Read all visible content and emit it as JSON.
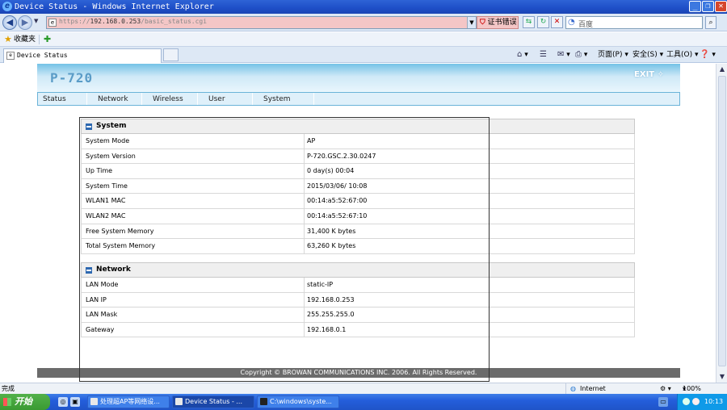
{
  "window": {
    "title": "Device Status - Windows Internet Explorer",
    "icon": "e"
  },
  "toolbar": {
    "url_prefix": "https://",
    "url_host": "192.168.0.253",
    "url_path": "/basic_status.cgi",
    "cert_error": "证书错误",
    "search_placeholder": "百度"
  },
  "favorites": {
    "label": "收藏夹"
  },
  "tab": {
    "title": "Device Status"
  },
  "commands": {
    "page": "页面(P)",
    "safety": "安全(S)",
    "tools": "工具(O)"
  },
  "device": {
    "logo": "P-720",
    "exit": "EXIT",
    "menu": [
      "Status",
      "Network",
      "Wireless",
      "User",
      "System"
    ],
    "system_section": {
      "title": "System",
      "rows": [
        {
          "key": "System Mode",
          "value": "AP"
        },
        {
          "key": "System Version",
          "value": "P-720.GSC.2.30.0247"
        },
        {
          "key": "Up Time",
          "value": "0 day(s) 00:04"
        },
        {
          "key": "System Time",
          "value": "2015/03/06/ 10:08"
        },
        {
          "key": "WLAN1 MAC",
          "value": "00:14:a5:52:67:00"
        },
        {
          "key": "WLAN2 MAC",
          "value": "00:14:a5:52:67:10"
        },
        {
          "key": "Free System Memory",
          "value": "31,400 K bytes"
        },
        {
          "key": "Total System Memory",
          "value": "63,260 K bytes"
        }
      ]
    },
    "network_section": {
      "title": "Network",
      "rows": [
        {
          "key": "LAN Mode",
          "value": "static-IP"
        },
        {
          "key": "LAN IP",
          "value": "192.168.0.253"
        },
        {
          "key": "LAN Mask",
          "value": "255.255.255.0"
        },
        {
          "key": "Gateway",
          "value": "192.168.0.1"
        }
      ]
    },
    "footer": "Copyright © BROWAN COMMUNICATIONS INC. 2006.  All Rights Reserved."
  },
  "statusbar": {
    "left": "完成",
    "zone": "Internet",
    "zoom": "100%"
  },
  "taskbar": {
    "start": "开始",
    "buttons": [
      "处理超AP等网络设...",
      "Device Status - ...",
      "C:\\windows\\syste..."
    ],
    "clock": "10:13"
  }
}
